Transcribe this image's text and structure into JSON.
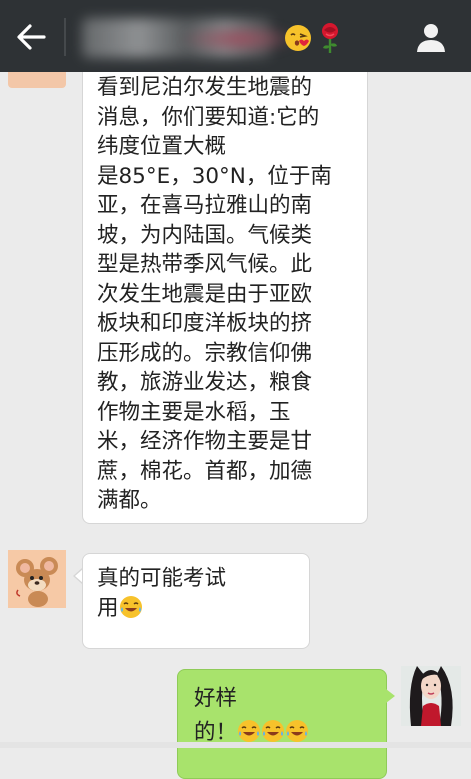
{
  "header": {
    "contact_name": "",
    "back_icon": "arrow-left-icon",
    "profile_icon": "person-icon",
    "title_emojis": [
      "kissing-face-icon",
      "rose-icon"
    ]
  },
  "messages": [
    {
      "sender": "contact",
      "lines": [
        "看到尼泊尔发生地震的",
        "消息，你们要知道:它的",
        "纬度位置大概",
        "是85°E，30°N，位于南",
        "亚，在喜马拉雅山的南",
        "坡，为内陆国。气候类",
        "型是热带季风气候。此",
        "次发生地震是由于亚欧",
        "板块和印度洋板块的挤",
        "压形成的。宗教信仰佛",
        "教，旅游业发达，粮食",
        "作物主要是水稻，玉",
        "米，经济作物主要是甘",
        "蔗，棉花。首都，加德",
        "满都。"
      ]
    },
    {
      "sender": "contact",
      "lines": [
        "真的可能考试",
        "用"
      ],
      "emoji": "laughing-tears-icon"
    },
    {
      "sender": "me",
      "lines": [
        "好样",
        "的！"
      ],
      "emojis": [
        "laughing-tears-icon",
        "laughing-tears-icon",
        "laughing-tears-icon"
      ]
    }
  ],
  "colors": {
    "header_bg": "#2e3235",
    "chat_bg": "#ebebeb",
    "bubble_in": "#ffffff",
    "bubble_out": "#a8e36c"
  }
}
